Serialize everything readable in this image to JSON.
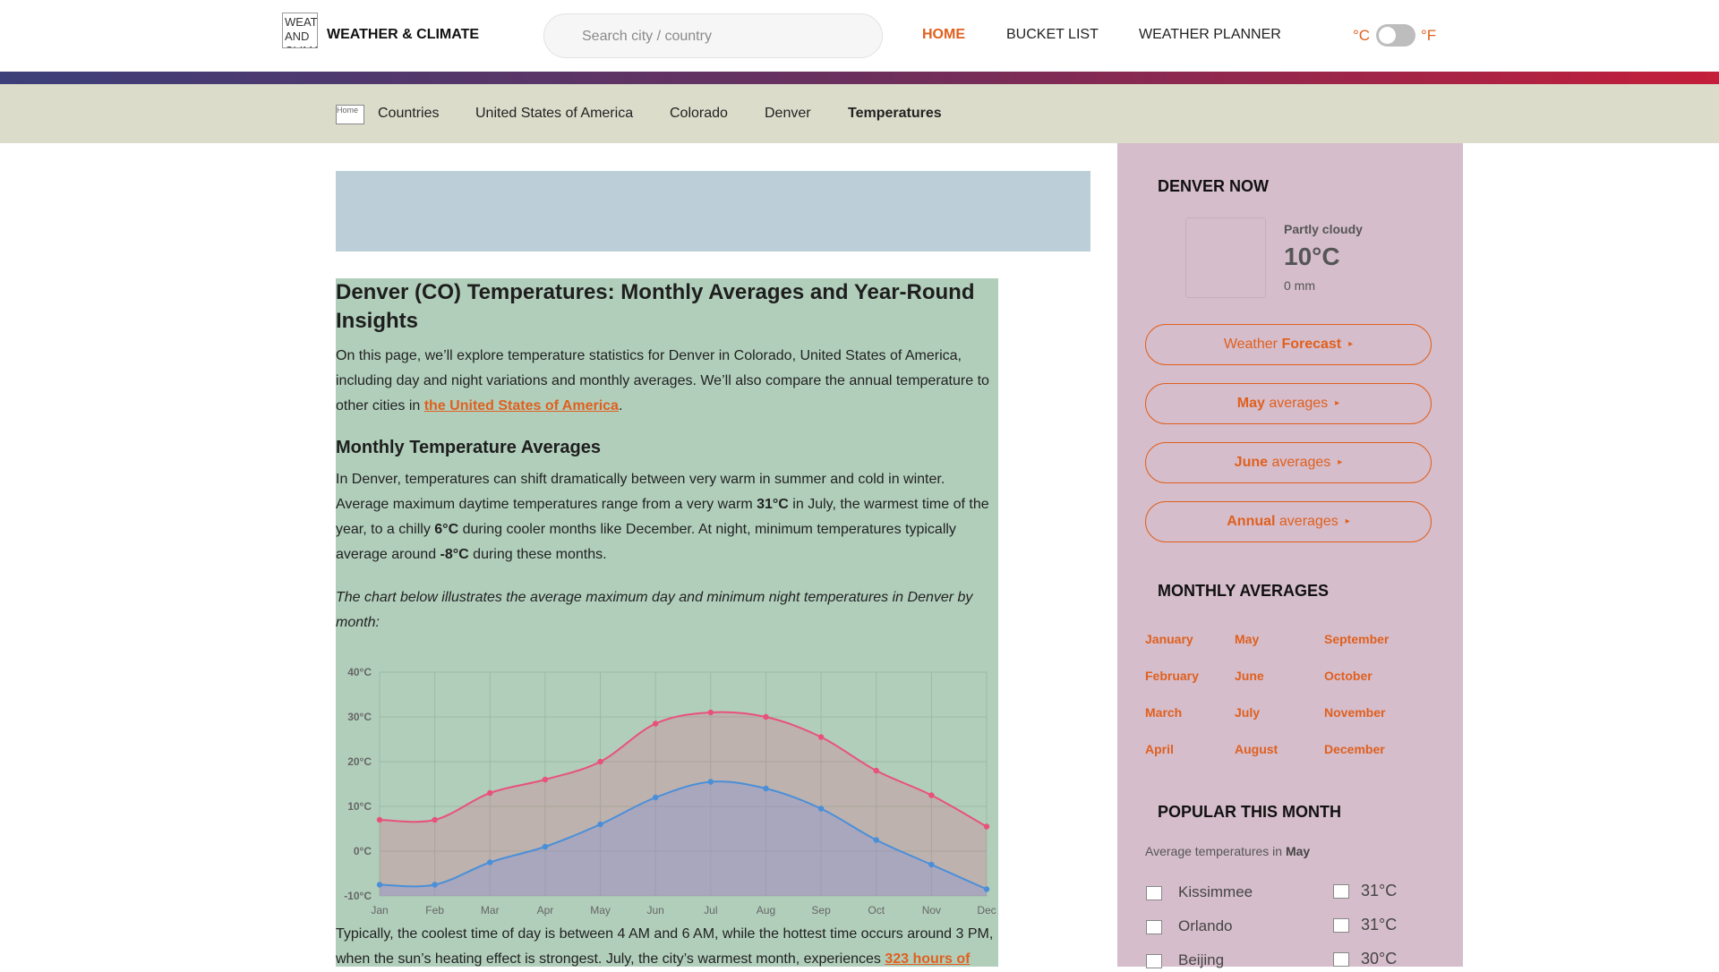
{
  "header": {
    "logo_alt": "WEATHER AND CLIMATE",
    "brand": "WEATHER & CLIMATE",
    "search_placeholder": "Search city / country",
    "nav": [
      "HOME",
      "BUCKET LIST",
      "WEATHER PLANNER"
    ],
    "unit_c": "°C",
    "unit_f": "°F",
    "accent_color": "#e0601e"
  },
  "breadcrumb": {
    "home_icon_alt": "Home",
    "items": [
      "Countries",
      "United States of America",
      "Colorado",
      "Denver",
      "Temperatures"
    ]
  },
  "article": {
    "title": "Denver (CO) Temperatures: Monthly Averages and Year-Round Insights",
    "intro": "On this page, we’ll explore temperature statistics for Denver in Colorado, United States of America, including day and night variations and monthly averages. We’ll also compare the annual temperature to other cities in ",
    "intro_link": "the United States of America",
    "intro_end": ".",
    "section_title": "Monthly Temperature Averages",
    "p2_a": "In Denver, temperatures can shift dramatically between very warm in summer and cold in winter. Average maximum daytime temperatures range from a very warm ",
    "p2_b": "31°C",
    "p2_c": " in July, the warmest time of the year, to a chilly ",
    "p2_d": "6°C",
    "p2_e": " during cooler months like December. At night, minimum temperatures typically average around ",
    "p2_f": "-8°C",
    "p2_g": " during these months.",
    "chart_caption": "The chart below illustrates the average maximum day and minimum night temperatures in Denver by month:",
    "p3": "Typically, the coolest time of day is between 4 AM and 6 AM, while the hottest time occurs around 3 PM, when the sun’s heating effect is strongest. July, the city’s warmest month, experiences ",
    "p3_link": "323 hours of"
  },
  "chart_data": {
    "type": "area",
    "categories": [
      "Jan",
      "Feb",
      "Mar",
      "Apr",
      "May",
      "Jun",
      "Jul",
      "Aug",
      "Sep",
      "Oct",
      "Nov",
      "Dec"
    ],
    "series": [
      {
        "color": "#e8527a",
        "values": [
          7,
          7,
          13,
          16,
          20,
          28.5,
          31,
          30,
          25.5,
          18,
          12.5,
          5.5
        ]
      },
      {
        "color": "#4a8fd9",
        "values": [
          -7.5,
          -7.5,
          -2.5,
          1,
          6,
          12,
          15.5,
          14,
          9.5,
          2.5,
          -3,
          -8.5
        ]
      }
    ],
    "yticks": [
      "40°C",
      "30°C",
      "20°C",
      "10°C",
      "0°C",
      "-10°C"
    ],
    "ylim": [
      -10,
      40
    ],
    "grid": true
  },
  "sidebar": {
    "now_title": "DENVER NOW",
    "now_icon": "partly-cloudy-icon",
    "now_condition": "Partly cloudy",
    "now_temp": "10°C",
    "now_rain": "0 mm",
    "buttons": [
      {
        "a": "Weather ",
        "b": "Forecast",
        "arrow": "▸"
      },
      {
        "a": "May",
        "b": " averages",
        "arrow": "▸"
      },
      {
        "a": "June",
        "b": " averages",
        "arrow": "▸"
      },
      {
        "a": "Annual",
        "b": " averages",
        "arrow": "▸"
      }
    ],
    "monthly_title": "MONTHLY AVERAGES",
    "months": [
      "January",
      "February",
      "March",
      "April",
      "May",
      "June",
      "July",
      "August",
      "September",
      "October",
      "November",
      "December"
    ],
    "popular_title": "POPULAR THIS MONTH",
    "popular_sub_a": "Average temperatures in ",
    "popular_sub_b": "May",
    "popular": [
      {
        "city": "Kissimmee",
        "temp": "31°C"
      },
      {
        "city": "Orlando",
        "temp": "31°C"
      },
      {
        "city": "Beijing",
        "temp": "30°C"
      }
    ]
  }
}
